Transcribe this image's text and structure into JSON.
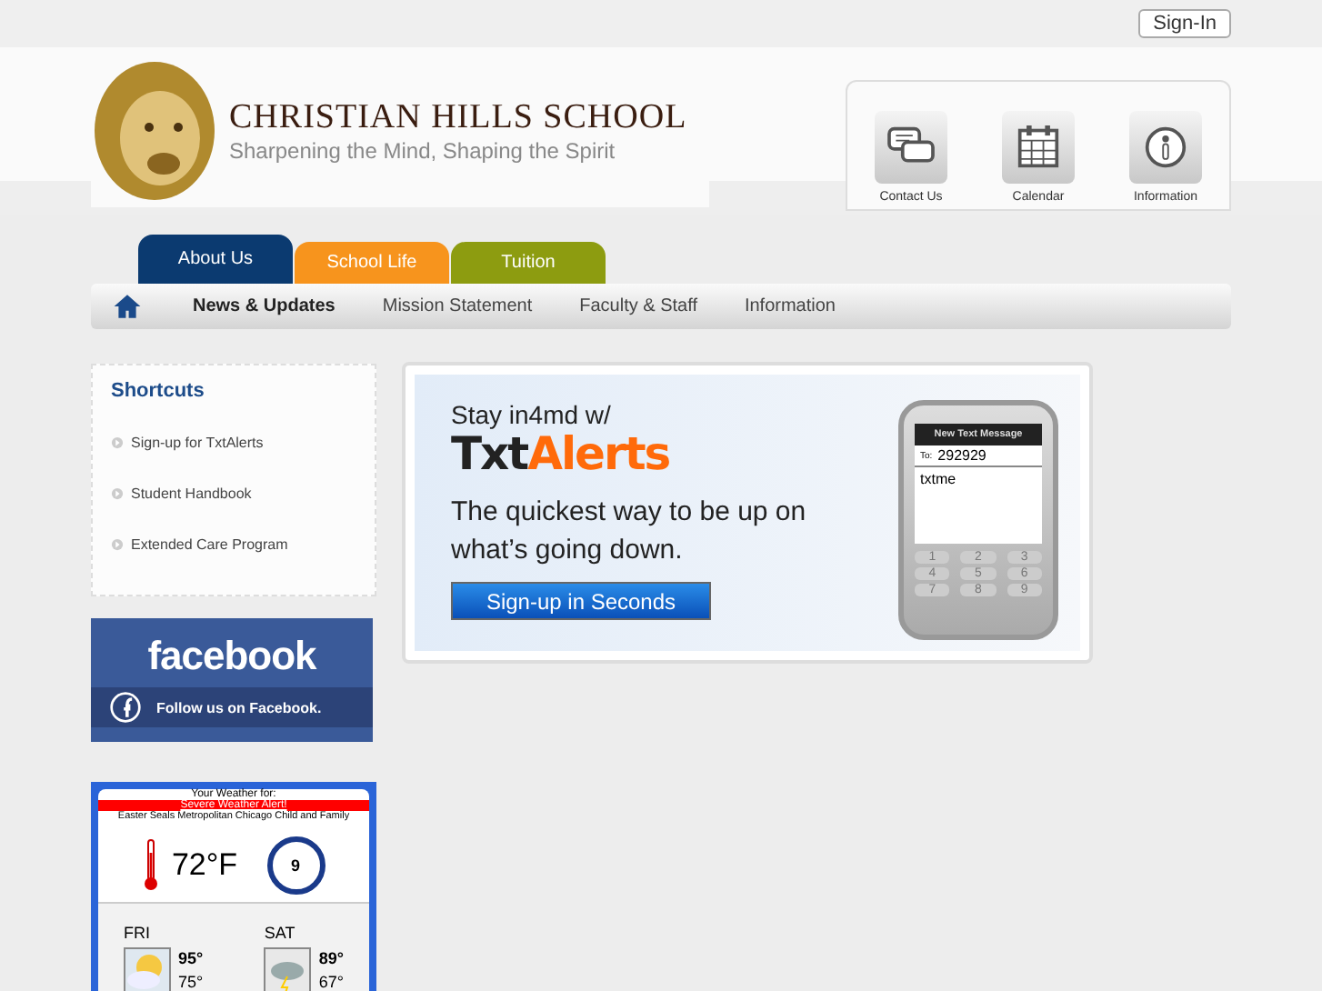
{
  "top_bar": {
    "sign_in": "Sign-In"
  },
  "header": {
    "school_name": "CHRISTIAN HILLS SCHOOL",
    "tagline": "Sharpening the Mind, Shaping the Spirit",
    "quick_links": [
      {
        "kind": "chat",
        "label": "Contact Us"
      },
      {
        "kind": "calendar",
        "label": "Calendar"
      },
      {
        "kind": "info",
        "label": "Information"
      }
    ]
  },
  "tabs": [
    {
      "label": "About Us",
      "selected": true,
      "color": "#0b3a70"
    },
    {
      "label": "School Life",
      "selected": false,
      "color": "#f7941d"
    },
    {
      "label": "Tuition",
      "selected": false,
      "color": "#8d9c10"
    }
  ],
  "nav": [
    {
      "label": "News & Updates",
      "selected": true
    },
    {
      "label": "Mission Statement",
      "selected": false
    },
    {
      "label": "Faculty & Staff",
      "selected": false
    },
    {
      "label": "Information",
      "selected": false
    }
  ],
  "shortcuts": {
    "title": "Shortcuts",
    "items": [
      "Sign-up for TxtAlerts",
      "Student Handbook",
      "Extended Care Program"
    ]
  },
  "facebook": {
    "logo": "facebook",
    "follow": "Follow us on Facebook."
  },
  "weather": {
    "heading": "Your Weather for:",
    "alert": "Severe Weather Alert!",
    "location": "Easter Seals Metropolitan Chicago Child and Family",
    "temperature": "72°F",
    "wind": "9",
    "forecast": [
      {
        "day": "FRI",
        "kind": "sunny",
        "high": "95°",
        "low": "75°"
      },
      {
        "day": "SAT",
        "kind": "storm",
        "high": "89°",
        "low": "67°"
      }
    ]
  },
  "banner": {
    "line1": "Stay in4md w/",
    "brand_a": "Txt",
    "brand_b": "Alerts",
    "body": "The quickest way to be up on what’s going down.",
    "button": "Sign-up in Seconds",
    "phone": {
      "title": "New Text Message",
      "to_label": "To:",
      "to": "292929",
      "message": "txtme",
      "keys": [
        "1",
        "2",
        "3",
        "4",
        "5",
        "6",
        "7",
        "8",
        "9"
      ]
    }
  }
}
